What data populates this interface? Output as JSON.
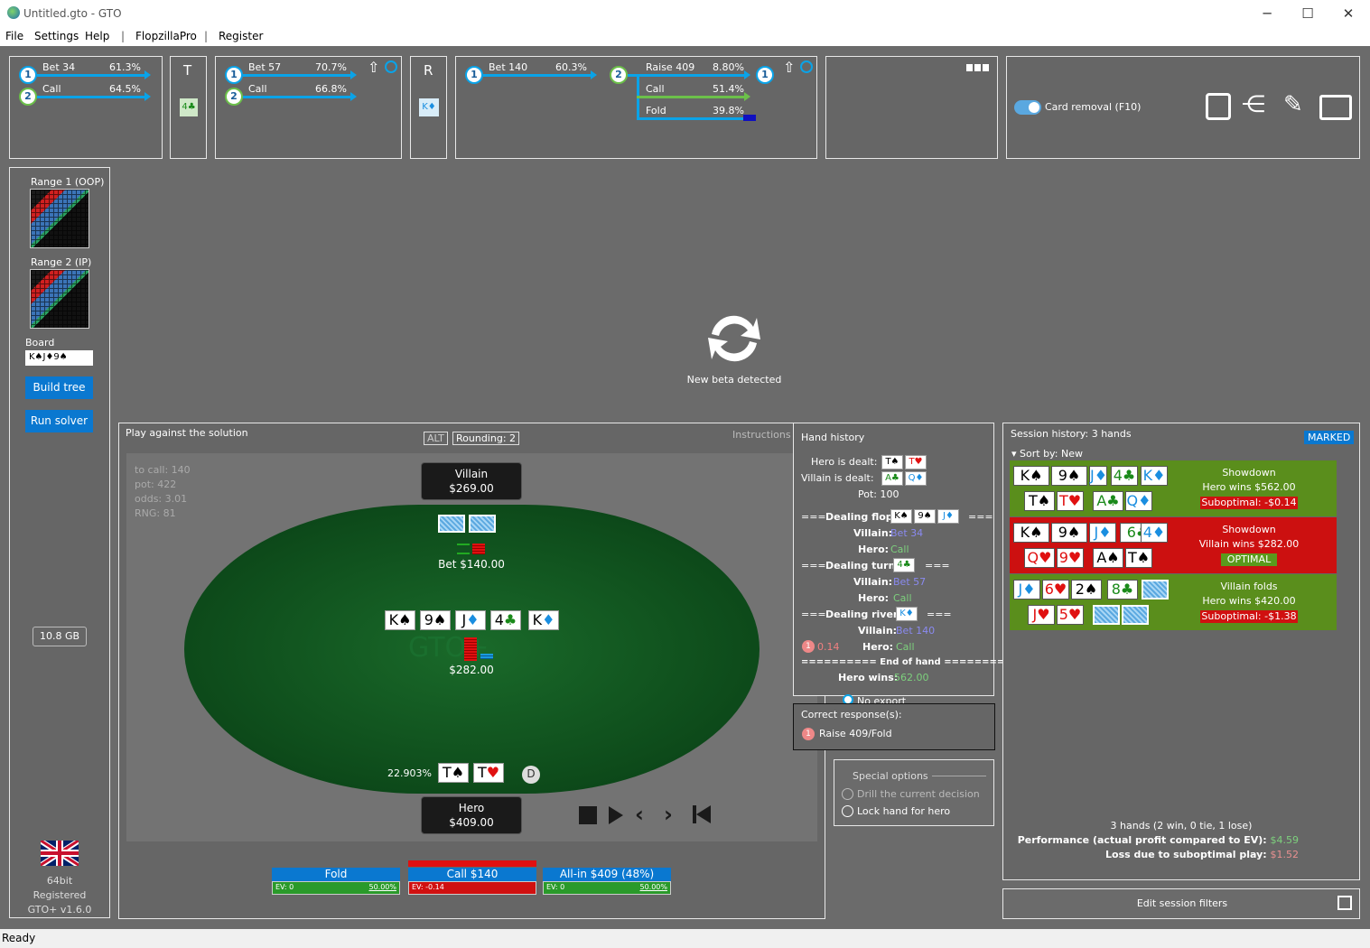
{
  "window": {
    "title": "Untitled.gto - GTO"
  },
  "menu": [
    "File",
    "Settings",
    "Help",
    "|",
    "FlopzillaPro",
    "|",
    "Register"
  ],
  "tree": {
    "flop": {
      "n1_label": "Bet 34",
      "n1_pct": "61.3%",
      "n2_label": "Call",
      "n2_pct": "64.5%"
    },
    "turn_label": "T",
    "turn_card": "4♣",
    "turn_node": {
      "n1_label": "Bet 57",
      "n1_pct": "70.7%",
      "n2_label": "Call",
      "n2_pct": "66.8%"
    },
    "river_label": "R",
    "river_card": "K♦",
    "river_node": {
      "n1_label": "Bet 140",
      "n1_pct": "60.3%",
      "n2_label": "Raise 409",
      "n2_pct": "8.80%",
      "call_label": "Call",
      "call_pct": "51.4%",
      "fold_label": "Fold",
      "fold_pct": "39.8%"
    },
    "card_removal": "Card removal (F10)"
  },
  "left": {
    "range1": "Range 1 (OOP)",
    "range2": "Range 2 (IP)",
    "board_label": "Board",
    "board_value": "K♠J♦9♠",
    "build_tree": "Build tree",
    "run_solver": "Run solver",
    "memory": "10.8 GB",
    "bits": "64bit",
    "registered": "Registered",
    "version": "GTO+ v1.6.0"
  },
  "beta": {
    "text": "New beta detected"
  },
  "play": {
    "title": "Play against the solution",
    "alt": "ALT",
    "rounding": "Rounding: 2",
    "instructions": "Instructions",
    "to_call": "to call: 140",
    "pot": "pot: 422",
    "odds": "odds: 3.01",
    "rng": "RNG: 81",
    "villain_name": "Villain",
    "villain_stack": "$269.00",
    "villain_bet": "Bet $140.00",
    "board": [
      {
        "r": "K",
        "s": "♠",
        "c": "spade"
      },
      {
        "r": "9",
        "s": "♠",
        "c": "spade"
      },
      {
        "r": "J",
        "s": "♦",
        "c": "diamond"
      },
      {
        "r": "4",
        "s": "♣",
        "c": "club"
      },
      {
        "r": "K",
        "s": "♦",
        "c": "diamond"
      }
    ],
    "pot_amount": "$282.00",
    "hero_equity": "22.903%",
    "hero_cards": [
      {
        "r": "T",
        "s": "♠",
        "c": "spade"
      },
      {
        "r": "T",
        "s": "♥",
        "c": "heart"
      }
    ],
    "dealer": "D",
    "hero_name": "Hero",
    "hero_stack": "$409.00",
    "actions": [
      {
        "label": "Fold",
        "ev": "EV: 0",
        "freq": "50.00%"
      },
      {
        "label": "Call $140",
        "ev": "EV: -0.14",
        "freq": ""
      },
      {
        "label": "All-in $409 (48%)",
        "ev": "EV: 0",
        "freq": "50.00%"
      }
    ]
  },
  "hand_history": {
    "title": "Hand history",
    "hero_dealt": "Hero is dealt:",
    "hero_cards": [
      "T♠",
      "T♥"
    ],
    "villain_dealt": "Villain is dealt:",
    "villain_cards": [
      "A♣",
      "Q♦"
    ],
    "pot": "Pot: 100",
    "flop_pre": "===",
    "flop": "Dealing flop:",
    "flop_cards": [
      "K♠",
      "9♠",
      "J♦"
    ],
    "flop_post": "===",
    "flop_villain": "Villain:",
    "flop_villain_act": "Bet 34",
    "flop_hero": "Hero:",
    "flop_hero_act": "Call",
    "turn_pre": "===",
    "turn": "Dealing turn:",
    "turn_card": "4♣",
    "turn_post": "===",
    "turn_villain": "Villain:",
    "turn_villain_act": "Bet 57",
    "turn_hero": "Hero:",
    "turn_hero_act": "Call",
    "river_pre": "===",
    "river": "Dealing river:",
    "river_card": "K♦",
    "river_post": "===",
    "river_villain": "Villain:",
    "river_villain_act": "Bet 140",
    "river_mistake": "0.14",
    "river_hero": "Hero:",
    "river_hero_act": "Call",
    "end": "========== End of hand ==========",
    "hero_wins": "Hero wins:",
    "hero_wins_amt": "562.00",
    "no_export": "No export"
  },
  "correct": {
    "title": "Correct response(s):",
    "num": "1",
    "value": "Raise 409/Fold"
  },
  "special": {
    "title": "Special options",
    "drill": "Drill the current decision",
    "lock": "Lock hand for hero"
  },
  "session": {
    "title": "Session history: 3 hands",
    "marked": "MARKED",
    "sort": "Sort by: New",
    "hands": [
      {
        "result": "Showdown",
        "who": "Hero wins $562.00",
        "badge": "Suboptimal: -$0.14",
        "board": [
          "K♠",
          "9♠",
          "J♦",
          "4♣",
          "K♦"
        ],
        "hand1": [
          "T♠",
          "T♥"
        ],
        "hand2": [
          "A♣",
          "Q♦"
        ]
      },
      {
        "result": "Showdown",
        "who": "Villain wins $282.00",
        "badge": "OPTIMAL",
        "board": [
          "K♠",
          "9♠",
          "J♦",
          "6♣",
          "4♦"
        ],
        "hand1": [
          "Q♥",
          "9♥"
        ],
        "hand2": [
          "A♠",
          "T♠"
        ]
      },
      {
        "result": "Villain folds",
        "who": "Hero wins $420.00",
        "badge": "Suboptimal: -$1.38",
        "board": [
          "J♦",
          "6♥",
          "2♠",
          "8♣"
        ],
        "hand1": [
          "J♥",
          "5♥"
        ],
        "hand2": []
      }
    ],
    "summary": "3 hands (2 win, 0 tie, 1 lose)",
    "performance_label": "Performance (actual profit compared to EV):",
    "performance_value": "$4.59",
    "loss_label": "Loss due to suboptimal play:",
    "loss_value": "$1.52",
    "edit_filters": "Edit session filters"
  },
  "status": {
    "text": "Ready"
  }
}
